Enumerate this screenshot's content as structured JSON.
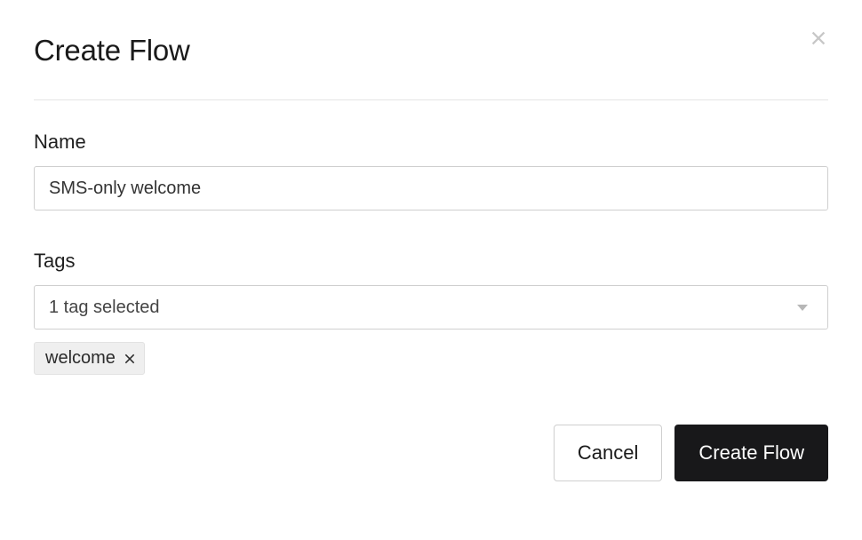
{
  "modal": {
    "title": "Create Flow",
    "name": {
      "label": "Name",
      "value": "SMS-only welcome"
    },
    "tags": {
      "label": "Tags",
      "selected_text": "1 tag selected",
      "chips": [
        {
          "label": "welcome"
        }
      ]
    },
    "actions": {
      "cancel": "Cancel",
      "submit": "Create Flow"
    }
  }
}
